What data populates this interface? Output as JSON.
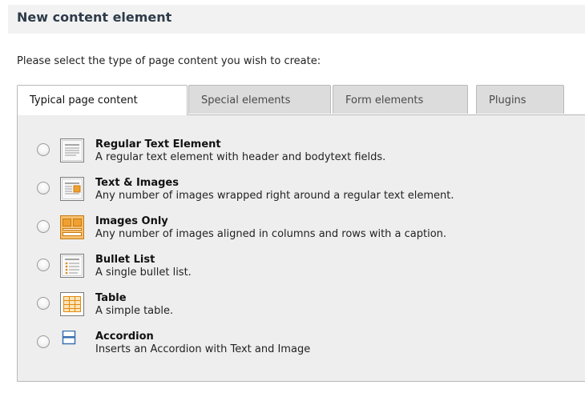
{
  "header": {
    "title": "New content element"
  },
  "instruction": "Please select the type of page content you wish to create:",
  "tabs": [
    {
      "label": "Typical page content",
      "active": true
    },
    {
      "label": "Special elements",
      "active": false
    },
    {
      "label": "Form elements",
      "active": false
    },
    {
      "label": "Plugins",
      "active": false
    }
  ],
  "items": [
    {
      "title": "Regular Text Element",
      "description": "A regular text element with header and bodytext fields.",
      "icon": "text-element-icon",
      "selected": false
    },
    {
      "title": "Text & Images",
      "description": "Any number of images wrapped right around a regular text element.",
      "icon": "text-images-icon",
      "selected": false
    },
    {
      "title": "Images Only",
      "description": "Any number of images aligned in columns and rows with a caption.",
      "icon": "images-only-icon",
      "selected": false
    },
    {
      "title": "Bullet List",
      "description": "A single bullet list.",
      "icon": "bullet-list-icon",
      "selected": false
    },
    {
      "title": "Table",
      "description": "A simple table.",
      "icon": "table-icon",
      "selected": false
    },
    {
      "title": "Accordion",
      "description": "Inserts an Accordion with Text and Image",
      "icon": "accordion-icon",
      "selected": false
    }
  ],
  "colors": {
    "title": "#2f3b4a",
    "panel_bg": "#eeeeee",
    "tab_inactive_bg": "#dcdcdc",
    "icon_orange": "#f0a030",
    "icon_blue": "#3a6fb0"
  }
}
